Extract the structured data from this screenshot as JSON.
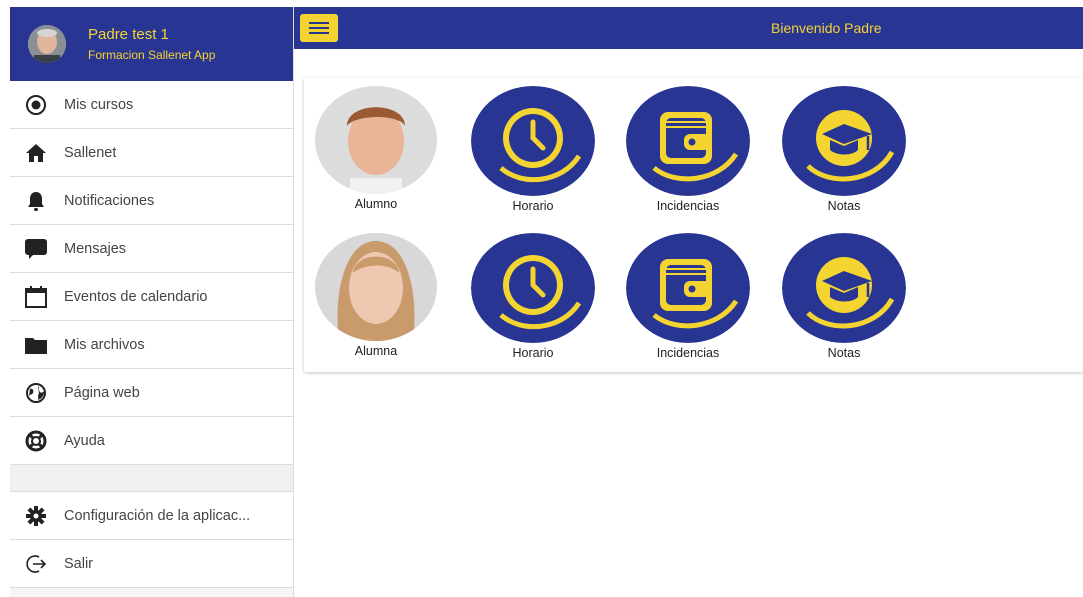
{
  "user": {
    "name": "Padre test 1",
    "subtitle": "Formacion Sallenet App"
  },
  "topbar": {
    "title": "Bienvenido Padre"
  },
  "sidebar": {
    "items": [
      {
        "label": "Mis cursos",
        "icon": "radio-icon"
      },
      {
        "label": "Sallenet",
        "icon": "home-icon"
      },
      {
        "label": "Notificaciones",
        "icon": "bell-icon"
      },
      {
        "label": "Mensajes",
        "icon": "chat-icon"
      },
      {
        "label": "Eventos de calendario",
        "icon": "calendar-icon"
      },
      {
        "label": "Mis archivos",
        "icon": "folder-icon"
      },
      {
        "label": "Página web",
        "icon": "globe-icon"
      },
      {
        "label": "Ayuda",
        "icon": "lifebuoy-icon"
      }
    ],
    "bottom_items": [
      {
        "label": "Configuración de la aplicac...",
        "icon": "gear-icon"
      },
      {
        "label": "Salir",
        "icon": "logout-icon"
      }
    ]
  },
  "students": [
    {
      "name": "Alumno",
      "actions": [
        "Horario",
        "Incidencias",
        "Notas"
      ]
    },
    {
      "name": "Alumna",
      "actions": [
        "Horario",
        "Incidencias",
        "Notas"
      ]
    }
  ],
  "colors": {
    "primary": "#283593",
    "accent": "#f4d431"
  }
}
